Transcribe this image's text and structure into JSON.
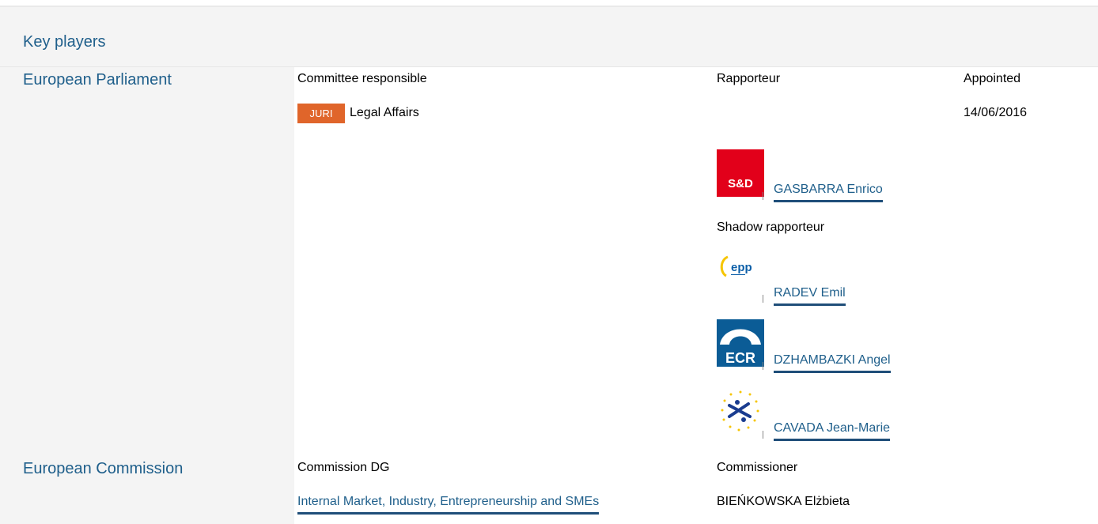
{
  "header": {
    "title": "Key players"
  },
  "parliament": {
    "label": "European Parliament",
    "committee_header": "Committee responsible",
    "rapporteur_header": "Rapporteur",
    "appointed_header": "Appointed",
    "committee_code": "JURI",
    "committee_name": "Legal Affairs",
    "appointed_date": "14/06/2016",
    "rapporteur": {
      "group_logo": "sd-group-logo",
      "logo_text": "S&D",
      "name": "GASBARRA Enrico"
    },
    "shadow_header": "Shadow rapporteur",
    "shadow_rapporteurs": [
      {
        "group_logo": "epp-group-logo",
        "logo_text": "epp",
        "name": "RADEV Emil"
      },
      {
        "group_logo": "ecr-group-logo",
        "logo_text": "ECR",
        "name": "DZHAMBAZKI Angel"
      },
      {
        "group_logo": "alde-group-logo",
        "name": "CAVADA Jean-Marie"
      }
    ]
  },
  "commission": {
    "label": "European Commission",
    "dg_header": "Commission DG",
    "commissioner_header": "Commissioner",
    "dg_name": "Internal Market, Industry, Entrepreneurship and SMEs",
    "commissioner_name": "BIEŃKOWSKA Elżbieta"
  },
  "colors": {
    "link": "#1f5f8b",
    "badge": "#e0652a",
    "panel_bg": "#f4f4f4"
  }
}
